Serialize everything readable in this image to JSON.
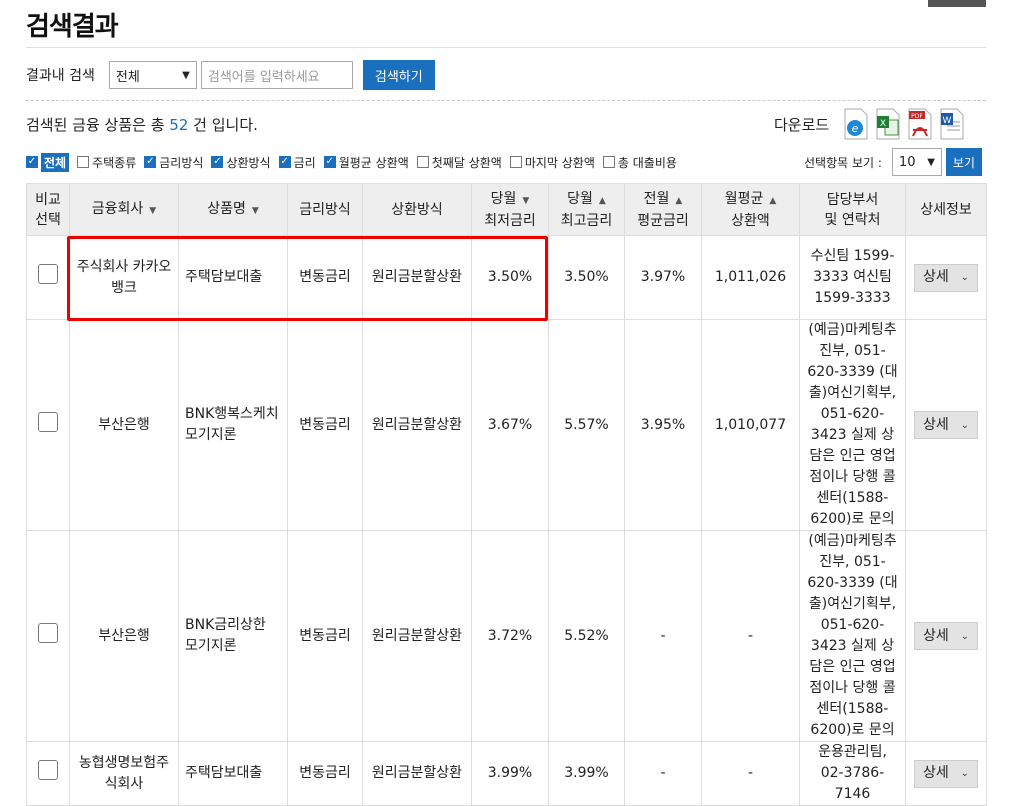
{
  "page_title": "검색결과",
  "search": {
    "label": "결과내 검색",
    "select_value": "전체",
    "placeholder": "검색어를 입력하세요",
    "button": "검색하기"
  },
  "count": {
    "prefix": "검색된 금융 상품은 총",
    "value": "52",
    "suffix": "건 입니다."
  },
  "download": {
    "label": "다운로드",
    "icons": [
      "ie-icon",
      "excel-icon",
      "pdf-icon",
      "word-icon"
    ]
  },
  "filters": [
    {
      "label": "전체",
      "checked": true
    },
    {
      "label": "주택종류",
      "checked": false
    },
    {
      "label": "금리방식",
      "checked": true
    },
    {
      "label": "상환방식",
      "checked": true
    },
    {
      "label": "금리",
      "checked": true
    },
    {
      "label": "월평균 상환액",
      "checked": true
    },
    {
      "label": "첫째달 상환액",
      "checked": false
    },
    {
      "label": "마지막 상환액",
      "checked": false
    },
    {
      "label": "총 대출비용",
      "checked": false
    }
  ],
  "view": {
    "label": "선택항목 보기 :",
    "value": "10",
    "button": "보기"
  },
  "table": {
    "headers": {
      "compare_1": "비교",
      "compare_2": "선택",
      "company": "금융회사",
      "product": "상품명",
      "rate_type": "금리방식",
      "repay": "상환방식",
      "min_rate_1": "당월",
      "min_rate_2": "최저금리",
      "max_rate_1": "당월",
      "max_rate_2": "최고금리",
      "avg_rate_1": "전월",
      "avg_rate_2": "평균금리",
      "monthly_1": "월평균",
      "monthly_2": "상환액",
      "contact_1": "담당부서",
      "contact_2": "및 연락처",
      "detail": "상세정보"
    },
    "rows": [
      {
        "company": "주식회사 카카오뱅크",
        "product": "주택담보대출",
        "rate_type": "변동금리",
        "repay": "원리금분할상환",
        "min_rate": "3.50%",
        "max_rate": "3.50%",
        "avg_rate": "3.97%",
        "monthly": "1,011,026",
        "contact": "수신팀 1599-3333 여신팀 1599-3333",
        "detail": "상세"
      },
      {
        "company": "부산은행",
        "product": "BNK행복스케치 모기지론",
        "rate_type": "변동금리",
        "repay": "원리금분할상환",
        "min_rate": "3.67%",
        "max_rate": "5.57%",
        "avg_rate": "3.95%",
        "monthly": "1,010,077",
        "contact": "(예금)마케팅추진부, 051-620-3339 (대출)여신기획부, 051-620-3423 실제 상담은 인근 영업점이나 당행 콜센터(1588-6200)로 문의",
        "detail": "상세"
      },
      {
        "company": "부산은행",
        "product": "BNK금리상한 모기지론",
        "rate_type": "변동금리",
        "repay": "원리금분할상환",
        "min_rate": "3.72%",
        "max_rate": "5.52%",
        "avg_rate": "-",
        "monthly": "-",
        "contact": "(예금)마케팅추진부, 051-620-3339 (대출)여신기획부, 051-620-3423 실제 상담은 인근 영업점이나 당행 콜센터(1588-6200)로 문의",
        "detail": "상세"
      },
      {
        "company": "농협생명보험주식회사",
        "product": "주택담보대출",
        "rate_type": "변동금리",
        "repay": "원리금분할상환",
        "min_rate": "3.99%",
        "max_rate": "3.99%",
        "avg_rate": "-",
        "monthly": "-",
        "contact": "운용관리팀, 02-3786-7146",
        "detail": "상세"
      }
    ]
  }
}
